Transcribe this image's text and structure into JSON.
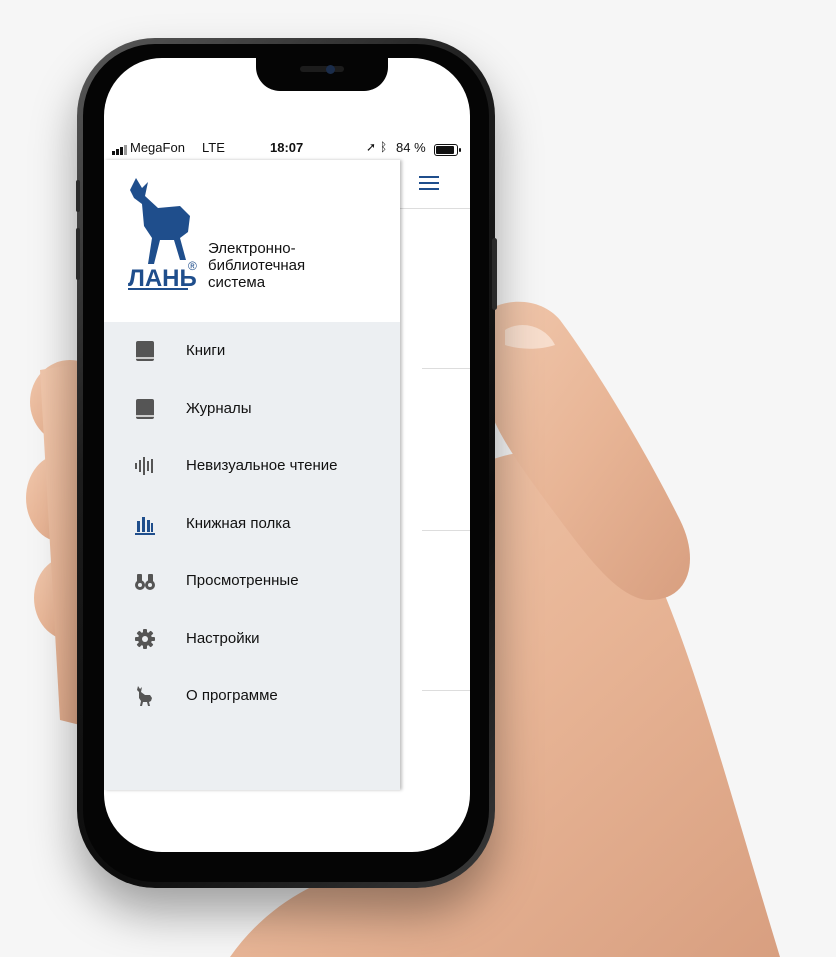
{
  "status_bar": {
    "carrier": "MegaFon",
    "network": "LTE",
    "time": "18:07",
    "battery": "84 %",
    "battery_level": 0.84
  },
  "drawer": {
    "logo_mark": "ЛАНЬ®",
    "logo_text_lines": [
      "Электронно-",
      "библиотечная",
      "система"
    ],
    "items": [
      {
        "label": "Книги",
        "icon": "book-icon"
      },
      {
        "label": "Журналы",
        "icon": "journal-icon"
      },
      {
        "label": "Невизуальное чтение",
        "icon": "audio-wave-icon"
      },
      {
        "label": "Книжная полка",
        "icon": "bookshelf-icon"
      },
      {
        "label": "Просмотренные",
        "icon": "binoculars-icon"
      },
      {
        "label": "Настройки",
        "icon": "gear-icon"
      },
      {
        "label": "О программе",
        "icon": "deer-icon"
      }
    ]
  },
  "colors": {
    "brand_blue": "#1f4e8c",
    "drawer_bg": "#eceff2",
    "icon_gray": "#555555"
  }
}
